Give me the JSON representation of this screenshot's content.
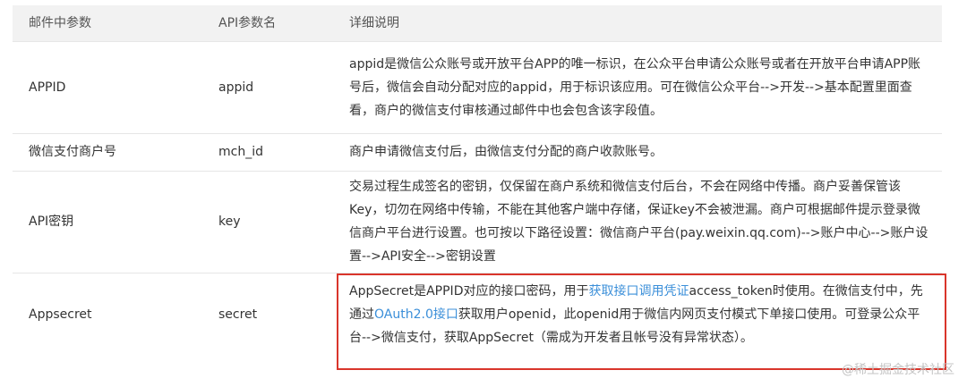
{
  "table": {
    "headers": [
      "邮件中参数",
      "API参数名",
      "详细说明"
    ],
    "rows": [
      {
        "param": "APPID",
        "api": "appid",
        "desc": "appid是微信公众账号或开放平台APP的唯一标识，在公众平台申请公众账号或者在开放平台申请APP账号后，微信会自动分配对应的appid，用于标识该应用。可在微信公众平台-->开发-->基本配置里面查看，商户的微信支付审核通过邮件中也会包含该字段值。"
      },
      {
        "param": "微信支付商户号",
        "api": "mch_id",
        "desc": "商户申请微信支付后，由微信支付分配的商户收款账号。"
      },
      {
        "param": "API密钥",
        "api": "key",
        "desc": "交易过程生成签名的密钥，仅保留在商户系统和微信支付后台，不会在网络中传播。商户妥善保管该Key，切勿在网络中传输，不能在其他客户端中存储，保证key不会被泄漏。商户可根据邮件提示登录微信商户平台进行设置。也可按以下路径设置：微信商户平台(pay.weixin.qq.com)-->账户中心-->账户设置-->API安全-->密钥设置"
      },
      {
        "param": "Appsecret",
        "api": "secret",
        "desc_parts": [
          {
            "text": "AppSecret是APPID对应的接口密码，用于",
            "link": false
          },
          {
            "text": "获取接口调用凭证",
            "link": true
          },
          {
            "text": "access_token时使用。在微信支付中，先通过",
            "link": false
          },
          {
            "text": "OAuth2.0接口",
            "link": true
          },
          {
            "text": "获取用户openid，此openid用于微信内网页支付模式下单接口使用。可登录公众平台-->微信支付，获取AppSecret（需成为开发者且帐号没有异常状态）。",
            "link": false
          }
        ]
      }
    ]
  },
  "watermark": "@稀土掘金技术社区",
  "colors": {
    "header_bg": "#f2f2f2",
    "link": "#3b8fd9",
    "highlight_border": "#d9352b"
  }
}
